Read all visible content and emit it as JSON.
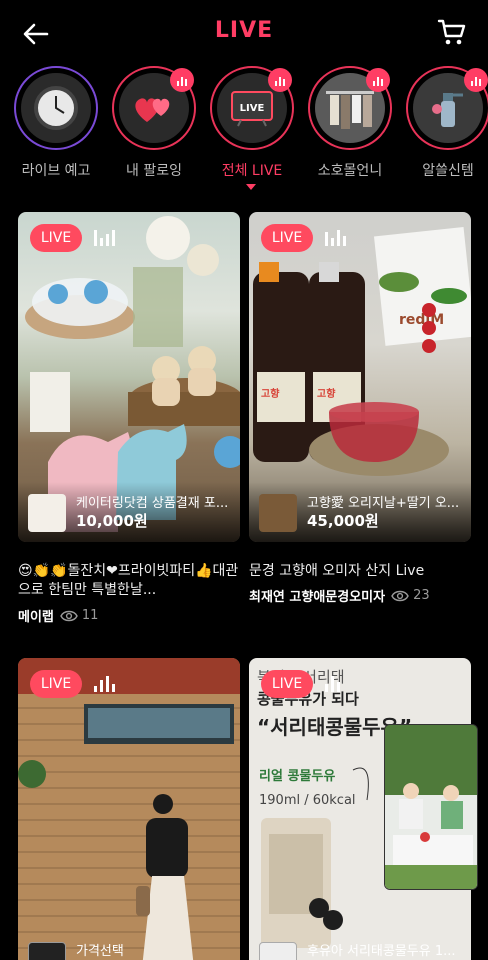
{
  "header": {
    "title": "LIVE"
  },
  "categories": [
    {
      "label": "라이브 예고",
      "icon": "clock-icon",
      "active": false
    },
    {
      "label": "내 팔로잉",
      "icon": "hearts-icon",
      "active": false
    },
    {
      "label": "전체 LIVE",
      "icon": "tv-live-icon",
      "active": true
    },
    {
      "label": "소호몰언니",
      "icon": "clothes-rack-icon",
      "active": false
    },
    {
      "label": "알쓸신템",
      "icon": "spray-bottle-icon",
      "active": false
    }
  ],
  "live_badge": "LIVE",
  "cards": [
    {
      "product_name": "케이터링닷컴 상품결재 포...",
      "price": "10,000원",
      "desc": "😍👏👏돌잔치❤프라이빗파티👍대관으로 한팀만 특별한날...",
      "host": "메이랩",
      "views": "11"
    },
    {
      "product_name": "고향愛 오리지날+딸기 오...",
      "price": "45,000원",
      "desc": "문경 고향애 오미자 산지 Live",
      "host": "최재연 고향애문경오미자",
      "views": "23"
    },
    {
      "product_name": "가격선택"
    },
    {
      "product_name": "후유아 서리태콩물두유 1...",
      "overlay_text_1": "콩물두유가 되다",
      "overlay_text_2": "“서리태콩물두유”",
      "overlay_text_3": "리얼 콩물두유",
      "overlay_text_4": "190ml / 60kcal"
    }
  ],
  "brand_text": "rediM"
}
